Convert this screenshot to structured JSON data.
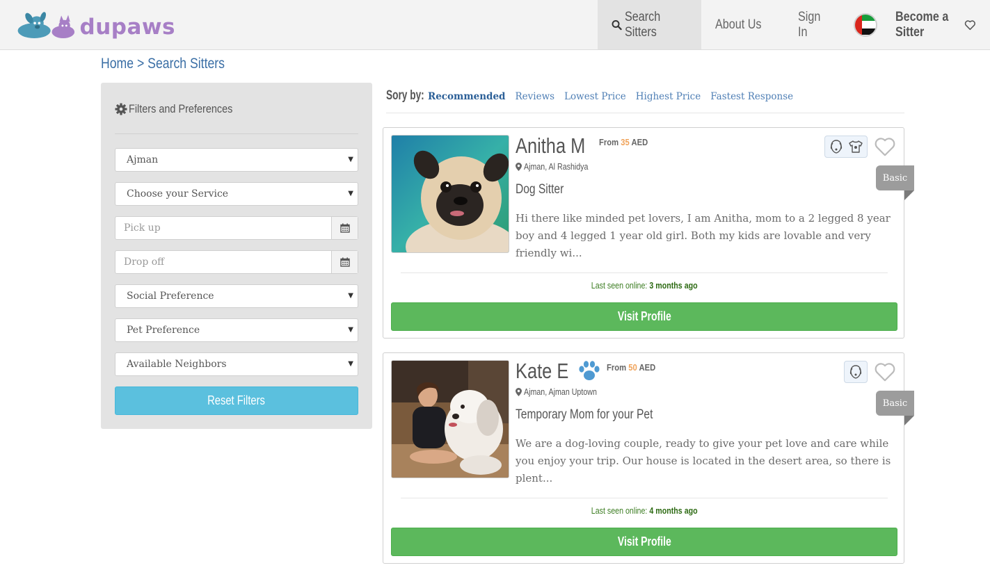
{
  "header": {
    "logo_text": "dupaws",
    "nav": {
      "search": "Search Sitters",
      "about": "About Us",
      "signin": "Sign In",
      "become": "Become a Sitter"
    }
  },
  "breadcrumb": {
    "home": "Home",
    "separator": ">",
    "current": "Search Sitters"
  },
  "filters": {
    "title": "Filters and Preferences",
    "city": "Ajman",
    "service": "Choose your Service",
    "pickup_placeholder": "Pick up",
    "dropoff_placeholder": "Drop off",
    "social": "Social Preference",
    "pet": "Pet Preference",
    "neighbors": "Available Neighbors",
    "reset": "Reset Filters"
  },
  "sort": {
    "label": "Sory by:",
    "options": [
      "Recommended",
      "Reviews",
      "Lowest Price",
      "Highest Price",
      "Fastest Response"
    ],
    "active_index": 0
  },
  "sitters": [
    {
      "name": "Anitha M",
      "price_prefix": "From",
      "price": "35",
      "currency": "AED",
      "location": "Ajman, Al Rashidya",
      "headline": "Dog Sitter",
      "description": "Hi there like minded pet lovers, I am Anitha, mom to a 2 legged 8 year boy and 4 legged 1 year old girl. Both my kids are lovable and very friendly wi...",
      "tier": "Basic",
      "last_seen_label": "Last seen online:",
      "last_seen": "3 months ago",
      "cta": "Visit Profile"
    },
    {
      "name": "Kate E",
      "price_prefix": "From",
      "price": "50",
      "currency": "AED",
      "location": "Ajman, Ajman Uptown",
      "headline": "Temporary Mom for your Pet",
      "description": "We are a dog-loving couple, ready to give your pet love and care while you enjoy your trip. Our house is located in the desert area, so there is plent...",
      "tier": "Basic",
      "last_seen_label": "Last seen online:",
      "last_seen": "4 months ago",
      "cta": "Visit Profile"
    }
  ],
  "colors": {
    "link": "#3a6ea5",
    "price_accent": "#f0a35a",
    "visit_button": "#5cb85c",
    "reset_button": "#5bc0de",
    "last_seen": "#3c7d22"
  }
}
